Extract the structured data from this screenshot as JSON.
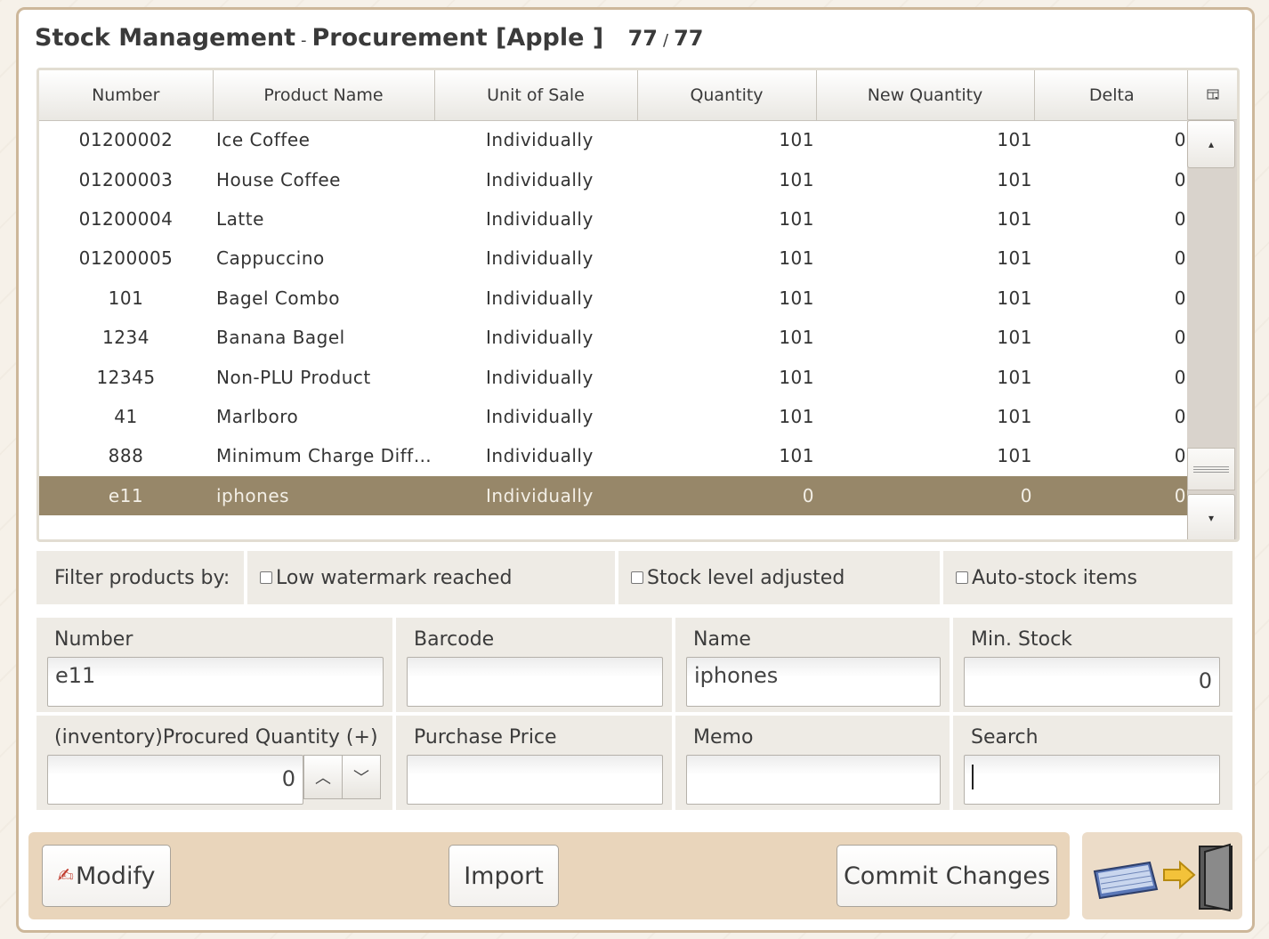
{
  "header": {
    "title_main": "Stock Management",
    "title_sep": "-",
    "title_sub": "Procurement [Apple ]",
    "count_current": "77",
    "count_sep": "/",
    "count_total": "77"
  },
  "grid": {
    "columns": [
      "Number",
      "Product Name",
      "Unit of Sale",
      "Quantity",
      "New Quantity",
      "Delta"
    ],
    "corner_icon": "column-settings-icon",
    "rows": [
      {
        "number": "01200002",
        "name": "Ice Coffee",
        "unit": "Individually",
        "qty": "101",
        "new_qty": "101",
        "delta": "0"
      },
      {
        "number": "01200003",
        "name": "House Coffee",
        "unit": "Individually",
        "qty": "101",
        "new_qty": "101",
        "delta": "0"
      },
      {
        "number": "01200004",
        "name": "Latte",
        "unit": "Individually",
        "qty": "101",
        "new_qty": "101",
        "delta": "0"
      },
      {
        "number": "01200005",
        "name": "Cappuccino",
        "unit": "Individually",
        "qty": "101",
        "new_qty": "101",
        "delta": "0"
      },
      {
        "number": "101",
        "name": "Bagel Combo",
        "unit": "Individually",
        "qty": "101",
        "new_qty": "101",
        "delta": "0"
      },
      {
        "number": "1234",
        "name": "Banana Bagel",
        "unit": "Individually",
        "qty": "101",
        "new_qty": "101",
        "delta": "0"
      },
      {
        "number": "12345",
        "name": "Non-PLU Product",
        "unit": "Individually",
        "qty": "101",
        "new_qty": "101",
        "delta": "0"
      },
      {
        "number": "41",
        "name": "Marlboro",
        "unit": "Individually",
        "qty": "101",
        "new_qty": "101",
        "delta": "0"
      },
      {
        "number": "888",
        "name": "Minimum Charge Diffe...",
        "unit": "Individually",
        "qty": "101",
        "new_qty": "101",
        "delta": "0"
      },
      {
        "number": "e11",
        "name": "iphones",
        "unit": "Individually",
        "qty": "0",
        "new_qty": "0",
        "delta": "0"
      }
    ],
    "selected_index": 9,
    "scroll_up_glyph": "▴",
    "scroll_down_glyph": "▾"
  },
  "filter": {
    "label": "Filter products by:",
    "options": [
      "Low watermark reached",
      "Stock level adjusted",
      "Auto-stock items"
    ]
  },
  "form": {
    "number_label": "Number",
    "number_value": "e11",
    "barcode_label": "Barcode",
    "barcode_value": "",
    "name_label": "Name",
    "name_value": "iphones",
    "min_stock_label": "Min. Stock",
    "min_stock_value": "0",
    "procured_label": "(inventory)Procured Quantity (+)",
    "procured_value": "0",
    "purchase_price_label": "Purchase Price",
    "purchase_price_value": "",
    "memo_label": "Memo",
    "memo_value": "",
    "search_label": "Search",
    "search_value": ""
  },
  "actions": {
    "modify_label": "Modify",
    "import_label": "Import",
    "commit_label": "Commit Changes"
  },
  "colors": {
    "selected_row": "#978769",
    "action_bar": "#e9d5bb",
    "window_border": "#cdb79a"
  }
}
